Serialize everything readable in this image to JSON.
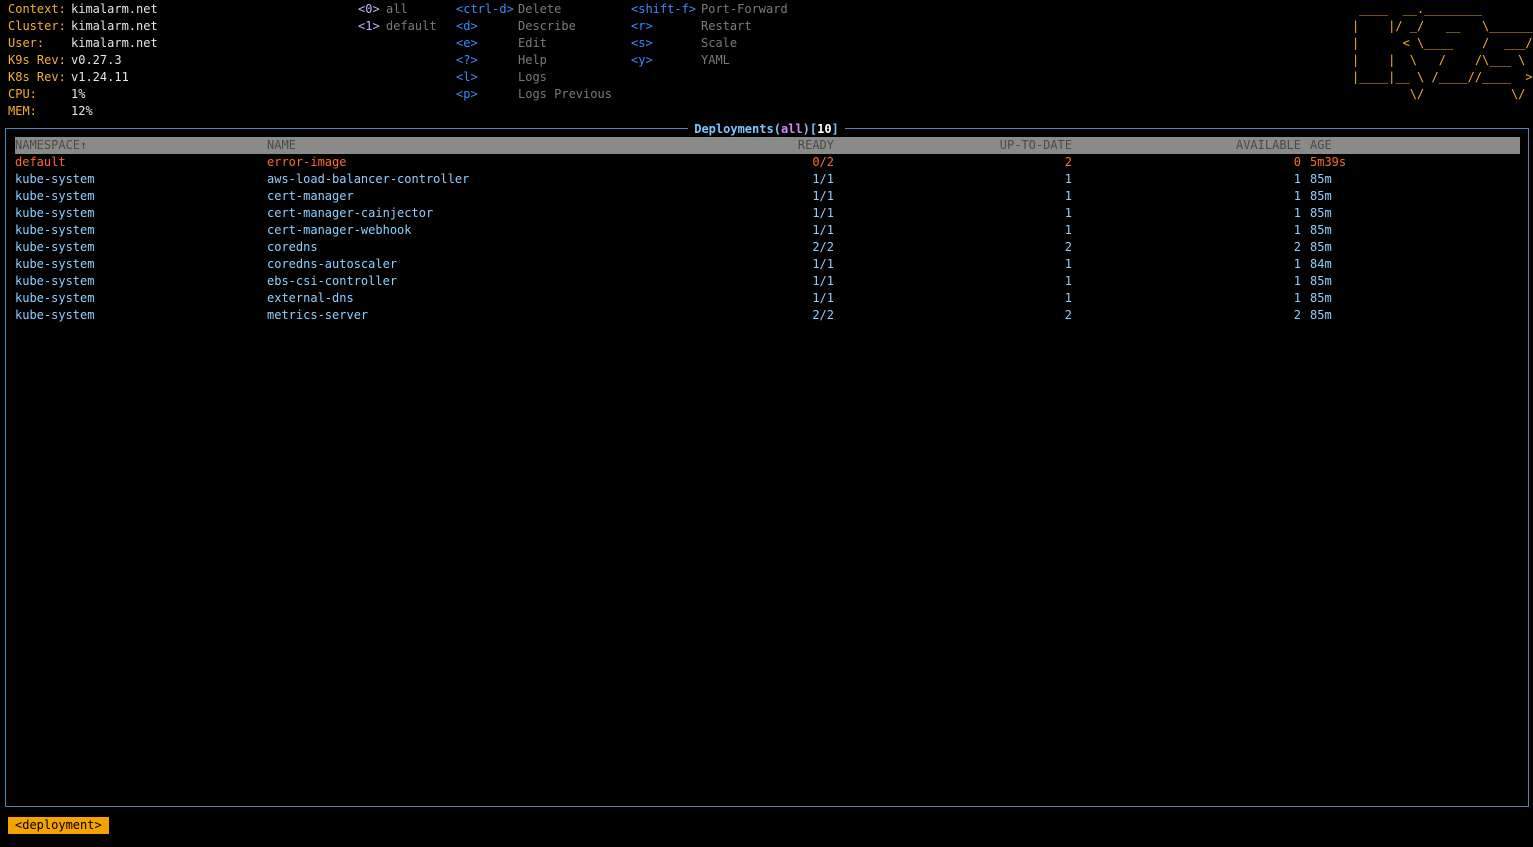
{
  "colors": {
    "background": "#000000",
    "accent_orange": "#f4b12a",
    "frame_blue": "#4c86b4",
    "row_cyan": "#8fcfff",
    "error_orange": "#ff6a2b",
    "hint_blue": "#3d8cf5",
    "ns_purple": "#c9b0ff"
  },
  "info": [
    {
      "key": "Context:",
      "value": "kimalarm.net"
    },
    {
      "key": "Cluster:",
      "value": "kimalarm.net"
    },
    {
      "key": "User:",
      "value": "kimalarm.net"
    },
    {
      "key": "K9s Rev:",
      "value": "v0.27.3"
    },
    {
      "key": "K8s Rev:",
      "value": "v1.24.11"
    },
    {
      "key": "CPU:",
      "value": "1%"
    },
    {
      "key": "MEM:",
      "value": "12%"
    }
  ],
  "namespaces": [
    {
      "key": "<0>",
      "label": "all"
    },
    {
      "key": "<1>",
      "label": "default"
    }
  ],
  "hints_col1": [
    {
      "key": "<ctrl-d>",
      "label": "Delete"
    },
    {
      "key": "<d>",
      "label": "Describe"
    },
    {
      "key": "<e>",
      "label": "Edit"
    },
    {
      "key": "<?>",
      "label": "Help"
    },
    {
      "key": "<l>",
      "label": "Logs"
    },
    {
      "key": "<p>",
      "label": "Logs Previous"
    }
  ],
  "hints_col2": [
    {
      "key": "<shift-f>",
      "label": "Port-Forward"
    },
    {
      "key": "<r>",
      "label": "Restart"
    },
    {
      "key": "<s>",
      "label": "Scale"
    },
    {
      "key": "<y>",
      "label": "YAML"
    }
  ],
  "logo": " ____  __.________\n|    |/ _/   __   \\______\n|      < \\____    /  ___/\n|    |  \\   /    /\\___ \\\n|____|__ \\ /____//____  >\n        \\/            \\/",
  "table": {
    "title": {
      "resource": "Deployments",
      "open": "(",
      "namespace": "all",
      "close": ")",
      "count_open": "[",
      "count": "10",
      "count_close": "]"
    },
    "columns": {
      "namespace": "NAMESPACE↑",
      "name": "NAME",
      "ready": "READY",
      "up_to_date": "UP-TO-DATE",
      "available": "AVAILABLE",
      "age": "AGE"
    },
    "rows": [
      {
        "namespace": "default",
        "name": "error-image",
        "ready": "0/2",
        "up_to_date": "2",
        "available": "0",
        "age": "5m39s",
        "status": "error"
      },
      {
        "namespace": "kube-system",
        "name": "aws-load-balancer-controller",
        "ready": "1/1",
        "up_to_date": "1",
        "available": "1",
        "age": "85m",
        "status": "normal"
      },
      {
        "namespace": "kube-system",
        "name": "cert-manager",
        "ready": "1/1",
        "up_to_date": "1",
        "available": "1",
        "age": "85m",
        "status": "normal"
      },
      {
        "namespace": "kube-system",
        "name": "cert-manager-cainjector",
        "ready": "1/1",
        "up_to_date": "1",
        "available": "1",
        "age": "85m",
        "status": "normal"
      },
      {
        "namespace": "kube-system",
        "name": "cert-manager-webhook",
        "ready": "1/1",
        "up_to_date": "1",
        "available": "1",
        "age": "85m",
        "status": "normal"
      },
      {
        "namespace": "kube-system",
        "name": "coredns",
        "ready": "2/2",
        "up_to_date": "2",
        "available": "2",
        "age": "85m",
        "status": "normal"
      },
      {
        "namespace": "kube-system",
        "name": "coredns-autoscaler",
        "ready": "1/1",
        "up_to_date": "1",
        "available": "1",
        "age": "84m",
        "status": "normal"
      },
      {
        "namespace": "kube-system",
        "name": "ebs-csi-controller",
        "ready": "1/1",
        "up_to_date": "1",
        "available": "1",
        "age": "85m",
        "status": "normal"
      },
      {
        "namespace": "kube-system",
        "name": "external-dns",
        "ready": "1/1",
        "up_to_date": "1",
        "available": "1",
        "age": "85m",
        "status": "normal"
      },
      {
        "namespace": "kube-system",
        "name": "metrics-server",
        "ready": "2/2",
        "up_to_date": "2",
        "available": "2",
        "age": "85m",
        "status": "normal"
      }
    ]
  },
  "crumb": "<deployment>"
}
